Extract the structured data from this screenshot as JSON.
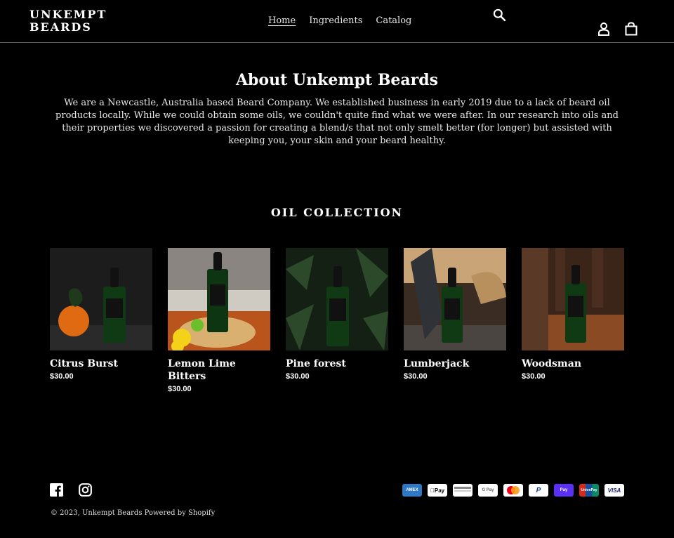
{
  "header": {
    "logo_line1": "UNKEMPT",
    "logo_line2": "BEARDS",
    "nav": [
      {
        "label": "Home"
      },
      {
        "label": "Ingredients"
      },
      {
        "label": "Catalog"
      }
    ],
    "icons": {
      "search": "search-icon",
      "account": "account-icon",
      "cart": "cart-icon"
    }
  },
  "about": {
    "title": "About Unkempt Beards",
    "text": "We are a Newcastle, Australia based Beard Company. We established business in early 2019 due to a lack of beard oil products locally. While we could obtain some oils, we couldn't quite find what we were after. In our research into oils and their properties we discovered a passion for creating a blend/s that not only smelt better (for longer) but assisted with keeping you, your skin and your beard healthy."
  },
  "collection": {
    "title": "OIL COLLECTION",
    "products": [
      {
        "name": "Citrus Burst",
        "price": "$30.00"
      },
      {
        "name": "Lemon Lime Bitters",
        "price": "$30.00"
      },
      {
        "name": "Pine forest",
        "price": "$30.00"
      },
      {
        "name": "Lumberjack",
        "price": "$30.00"
      },
      {
        "name": "Woodsman",
        "price": "$30.00"
      }
    ]
  },
  "footer": {
    "social": [
      "facebook-icon",
      "instagram-icon"
    ],
    "payments": [
      {
        "label": "AMEX",
        "bg": "#2f78c5",
        "fg": "#ffffff"
      },
      {
        "label": "Pay",
        "bg": "#ffffff",
        "fg": "#000000"
      },
      {
        "label": "",
        "bg": "#ffffff",
        "fg": "#000000"
      },
      {
        "label": "G Pay",
        "bg": "#ffffff",
        "fg": "#5f6368"
      },
      {
        "label": "",
        "bg": "#ffffff",
        "fg": "#000000"
      },
      {
        "label": "P",
        "bg": "#ffffff",
        "fg": "#253b80"
      },
      {
        "label": "Pay",
        "bg": "#5a31f4",
        "fg": "#ffffff"
      },
      {
        "label": "UnionPay",
        "bg": "#d52b1e",
        "fg": "#ffffff"
      },
      {
        "label": "VISA",
        "bg": "#ffffff",
        "fg": "#1a1f71"
      }
    ],
    "copyright_prefix": "© 2023,",
    "store_link": "Unkempt Beards",
    "powered": "Powered by Shopify"
  }
}
